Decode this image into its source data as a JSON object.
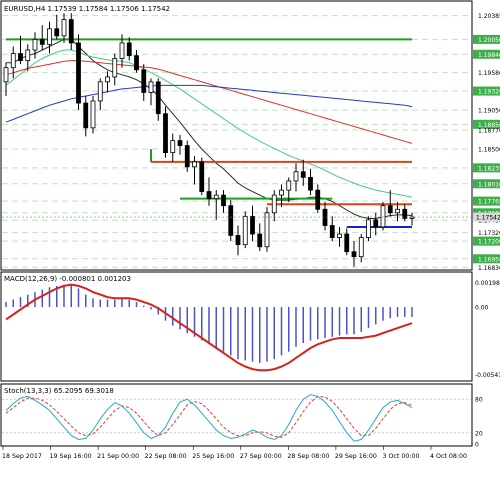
{
  "colors": {
    "bull": "#ffffff",
    "bear": "#000000",
    "grid": "#bfe3bf",
    "label_bg": "#3dae49",
    "ma_fast": "#2a2a2a",
    "ma_green": "#49c98b",
    "ma_red": "#e0302a",
    "ma_blue": "#2538c8",
    "level_green": "#1e9e1e",
    "level_red": "#d8451a",
    "level_blue": "#1326c8",
    "macd_hist": "#4b53c9",
    "macd_signal": "#d6221c",
    "stoch_main": "#26a9c9",
    "stoch_signal": "#e23a2a"
  },
  "chart_data": [
    {
      "type": "candlestick",
      "title": "EURUSD,H4 1.17539 1.17584 1.17506 1.17542",
      "ylim": [
        1.1682,
        1.2055
      ],
      "price_ticks": [
        "1.20385",
        "1.20050",
        "1.19840",
        "1.19580",
        "1.19320",
        "1.19050",
        "1.18850",
        "1.18770",
        "1.18500",
        "1.18235",
        "1.18010",
        "1.17765",
        "1.17600",
        "1.17495",
        "1.17320",
        "1.17200",
        "1.16950",
        "1.16830"
      ],
      "highlight_ticks": [
        "1.20050",
        "1.19840",
        "1.19320",
        "1.18850",
        "1.18235",
        "1.18010",
        "1.17765",
        "1.17600",
        "1.17200",
        "1.16950"
      ],
      "current_price_label": "1.17542",
      "x_tick_labels": [
        "18 Sep 2017",
        "19 Sep 16:00",
        "21 Sep 00:00",
        "22 Sep 08:00",
        "25 Sep 16:00",
        "27 Sep 00:00",
        "28 Sep 08:00",
        "29 Sep 16:00",
        "3 Oct 00:00",
        "4 Oct 08:00"
      ],
      "ohlc": [
        [
          1.1945,
          1.1972,
          1.1925,
          1.1965
        ],
        [
          1.1965,
          1.1995,
          1.195,
          1.1985
        ],
        [
          1.1985,
          1.201,
          1.197,
          1.1975
        ],
        [
          1.1975,
          1.1998,
          1.196,
          1.199
        ],
        [
          1.199,
          1.2015,
          1.1978,
          1.2005
        ],
        [
          1.2005,
          1.2025,
          1.199,
          1.1998
        ],
        [
          1.1998,
          1.203,
          1.1985,
          1.202
        ],
        [
          1.202,
          1.204,
          1.2005,
          1.201
        ],
        [
          1.201,
          1.2042,
          1.2,
          1.2033
        ],
        [
          1.2033,
          1.2042,
          1.199,
          1.2
        ],
        [
          1.2,
          1.2012,
          1.1905,
          1.1915
        ],
        [
          1.1915,
          1.1925,
          1.1868,
          1.188
        ],
        [
          1.188,
          1.1925,
          1.1872,
          1.1918
        ],
        [
          1.1918,
          1.195,
          1.1905,
          1.1945
        ],
        [
          1.1945,
          1.196,
          1.193,
          1.1952
        ],
        [
          1.1952,
          1.1985,
          1.194,
          1.1978
        ],
        [
          1.1978,
          1.2012,
          1.1965,
          1.2
        ],
        [
          1.2,
          1.2008,
          1.1975,
          1.1982
        ],
        [
          1.1982,
          1.199,
          1.1958,
          1.1962
        ],
        [
          1.1962,
          1.197,
          1.1918,
          1.193
        ],
        [
          1.193,
          1.195,
          1.1912,
          1.1945
        ],
        [
          1.1945,
          1.195,
          1.189,
          1.19
        ],
        [
          1.19,
          1.191,
          1.1838,
          1.1845
        ],
        [
          1.1845,
          1.1872,
          1.1832,
          1.1862
        ],
        [
          1.1862,
          1.187,
          1.1842,
          1.1855
        ],
        [
          1.1855,
          1.1862,
          1.1818,
          1.1825
        ],
        [
          1.1825,
          1.184,
          1.18,
          1.1832
        ],
        [
          1.1832,
          1.1838,
          1.1785,
          1.179
        ],
        [
          1.179,
          1.181,
          1.177,
          1.178
        ],
        [
          1.178,
          1.1792,
          1.175,
          1.1785
        ],
        [
          1.1785,
          1.1792,
          1.176,
          1.177
        ],
        [
          1.177,
          1.1778,
          1.172,
          1.1728
        ],
        [
          1.1728,
          1.1742,
          1.17,
          1.1715
        ],
        [
          1.1715,
          1.1762,
          1.171,
          1.1755
        ],
        [
          1.1755,
          1.177,
          1.172,
          1.173
        ],
        [
          1.173,
          1.1745,
          1.1706,
          1.1712
        ],
        [
          1.1712,
          1.1768,
          1.1705,
          1.176
        ],
        [
          1.176,
          1.1792,
          1.1748,
          1.1785
        ],
        [
          1.1785,
          1.18,
          1.1768,
          1.1792
        ],
        [
          1.1792,
          1.181,
          1.1775,
          1.1805
        ],
        [
          1.1805,
          1.183,
          1.179,
          1.1818
        ],
        [
          1.1818,
          1.1835,
          1.1798,
          1.181
        ],
        [
          1.181,
          1.1822,
          1.1785,
          1.1792
        ],
        [
          1.1792,
          1.18,
          1.176,
          1.1765
        ],
        [
          1.1765,
          1.1775,
          1.1735,
          1.1742
        ],
        [
          1.1742,
          1.1755,
          1.172,
          1.1725
        ],
        [
          1.1725,
          1.174,
          1.1712,
          1.173
        ],
        [
          1.173,
          1.1738,
          1.17,
          1.1705
        ],
        [
          1.1705,
          1.172,
          1.1684,
          1.1698
        ],
        [
          1.1698,
          1.173,
          1.169,
          1.1725
        ],
        [
          1.1725,
          1.1755,
          1.172,
          1.175
        ],
        [
          1.175,
          1.176,
          1.1728,
          1.174
        ],
        [
          1.174,
          1.1775,
          1.1735,
          1.177
        ],
        [
          1.177,
          1.1792,
          1.1755,
          1.176
        ],
        [
          1.176,
          1.1775,
          1.1748,
          1.1765
        ],
        [
          1.1765,
          1.1772,
          1.1748,
          1.1752
        ],
        [
          1.1752,
          1.176,
          1.1742,
          1.1754
        ]
      ],
      "moving_averages": [
        {
          "key": "ma_fast",
          "values": [
            1.1972,
            1.1972,
            1.1978,
            1.1982,
            1.1985,
            1.199,
            1.1995,
            1.2,
            1.2005,
            1.2005,
            1.1995,
            1.1985,
            1.1975,
            1.1968,
            1.1962,
            1.1958,
            1.1955,
            1.1952,
            1.1948,
            1.1942,
            1.1935,
            1.1925,
            1.1912,
            1.19,
            1.1888,
            1.1875,
            1.1862,
            1.185,
            1.184,
            1.183,
            1.1822,
            1.1812,
            1.1802,
            1.1795,
            1.179,
            1.1785,
            1.178,
            1.1778,
            1.1778,
            1.1778,
            1.1779,
            1.178,
            1.1782,
            1.1782,
            1.178,
            1.1776,
            1.177,
            1.1764,
            1.1758,
            1.1754,
            1.1752,
            1.1752,
            1.1754,
            1.1756,
            1.1757,
            1.1757,
            1.1756
          ]
        },
        {
          "key": "ma_green",
          "values": [
            1.194,
            1.1948,
            1.1956,
            1.1964,
            1.1972,
            1.1978,
            1.1983,
            1.1987,
            1.199,
            1.199,
            1.1987,
            1.1983,
            1.198,
            1.1978,
            1.1976,
            1.1975,
            1.1974,
            1.1972,
            1.1968,
            1.1963,
            1.1958,
            1.1953,
            1.1947,
            1.1941,
            1.1935,
            1.1928,
            1.1921,
            1.1914,
            1.1907,
            1.19,
            1.1893,
            1.1886,
            1.1879,
            1.1873,
            1.1867,
            1.1861,
            1.1856,
            1.1851,
            1.1846,
            1.1841,
            1.1837,
            1.1833,
            1.1829,
            1.1825,
            1.182,
            1.1815,
            1.181,
            1.1806,
            1.1802,
            1.1798,
            1.1795,
            1.1792,
            1.179,
            1.1788,
            1.1786,
            1.1784,
            1.1782
          ]
        },
        {
          "key": "ma_red",
          "values": [
            1.1955,
            1.1958,
            1.1961,
            1.1964,
            1.1966,
            1.1968,
            1.197,
            1.1972,
            1.1974,
            1.1975,
            1.1975,
            1.1974,
            1.1973,
            1.1972,
            1.1971,
            1.197,
            1.1969,
            1.1968,
            1.1967,
            1.1966,
            1.1965,
            1.1963,
            1.196,
            1.1957,
            1.1954,
            1.1951,
            1.1948,
            1.1945,
            1.1942,
            1.1939,
            1.1936,
            1.1933,
            1.193,
            1.1927,
            1.1924,
            1.1921,
            1.1918,
            1.1915,
            1.1912,
            1.1909,
            1.1906,
            1.1903,
            1.19,
            1.1897,
            1.1894,
            1.1891,
            1.1888,
            1.1885,
            1.1882,
            1.1879,
            1.1876,
            1.1873,
            1.187,
            1.1867,
            1.1864,
            1.1861,
            1.1858
          ]
        },
        {
          "key": "ma_blue",
          "values": [
            1.1888,
            1.1892,
            1.1896,
            1.19,
            1.1904,
            1.1908,
            1.1912,
            1.1915,
            1.1918,
            1.1921,
            1.1923,
            1.1925,
            1.1927,
            1.1929,
            1.1931,
            1.1933,
            1.1935,
            1.1936,
            1.1937,
            1.1938,
            1.1939,
            1.194,
            1.194,
            1.194,
            1.194,
            1.194,
            1.194,
            1.194,
            1.1939,
            1.1938,
            1.1937,
            1.1936,
            1.1935,
            1.1934,
            1.1933,
            1.1932,
            1.1931,
            1.193,
            1.1929,
            1.1928,
            1.1927,
            1.1926,
            1.1925,
            1.1924,
            1.1923,
            1.1922,
            1.1921,
            1.192,
            1.1919,
            1.1918,
            1.1917,
            1.1916,
            1.1915,
            1.1914,
            1.1913,
            1.1912,
            1.191
          ]
        }
      ],
      "levels": [
        {
          "price": 1.2005,
          "from": 0,
          "to": 56,
          "key": "level_green"
        },
        {
          "price": 1.1832,
          "from": 20,
          "to": 56,
          "key": "level_red"
        },
        {
          "price": 1.1832,
          "from": 20,
          "to": 20,
          "key": "level_green",
          "vertical_to": 1.185
        },
        {
          "price": 1.178,
          "from": 24,
          "to": 45,
          "key": "level_green"
        },
        {
          "price": 1.1772,
          "from": 36,
          "to": 56,
          "key": "level_red"
        },
        {
          "price": 1.174,
          "from": 47,
          "to": 56,
          "key": "level_blue"
        }
      ]
    },
    {
      "type": "macd",
      "title": "MACD(12,26,9) -0.000801 0.001203",
      "ylim": [
        -0.0058,
        0.0025
      ],
      "ticks": [
        "0.001981",
        "0.00",
        "-0.005419"
      ],
      "histogram": [
        0.0004,
        0.0006,
        0.0008,
        0.001,
        0.0012,
        0.0014,
        0.0016,
        0.0017,
        0.0018,
        0.0018,
        0.0015,
        0.001,
        0.0007,
        0.0006,
        0.0006,
        0.0006,
        0.0007,
        0.0006,
        0.0004,
        0.0001,
        -0.0002,
        -0.0006,
        -0.0011,
        -0.0015,
        -0.0018,
        -0.0021,
        -0.0024,
        -0.0027,
        -0.003,
        -0.0033,
        -0.0036,
        -0.0039,
        -0.0042,
        -0.0043,
        -0.0044,
        -0.0045,
        -0.0044,
        -0.0042,
        -0.0039,
        -0.0036,
        -0.0032,
        -0.0029,
        -0.0027,
        -0.0026,
        -0.0025,
        -0.0024,
        -0.0023,
        -0.0022,
        -0.0022,
        -0.002,
        -0.0017,
        -0.0014,
        -0.0011,
        -0.0009,
        -0.0008,
        -0.0008,
        -0.0008
      ],
      "signal": [
        -0.001,
        -0.0006,
        -0.0002,
        0.0002,
        0.0006,
        0.0009,
        0.0012,
        0.0015,
        0.0017,
        0.0018,
        0.0017,
        0.0015,
        0.0012,
        0.001,
        0.0008,
        0.0007,
        0.0007,
        0.0007,
        0.0006,
        0.0004,
        0.0002,
        -0.0001,
        -0.0005,
        -0.0009,
        -0.0013,
        -0.0017,
        -0.0021,
        -0.0025,
        -0.0029,
        -0.0033,
        -0.0037,
        -0.0041,
        -0.0045,
        -0.0048,
        -0.005,
        -0.0051,
        -0.0051,
        -0.005,
        -0.0048,
        -0.0045,
        -0.0041,
        -0.0037,
        -0.0033,
        -0.003,
        -0.0028,
        -0.0026,
        -0.0025,
        -0.0025,
        -0.0025,
        -0.0025,
        -0.0024,
        -0.0023,
        -0.0021,
        -0.0019,
        -0.0017,
        -0.0015,
        -0.0013
      ]
    },
    {
      "type": "stochastic",
      "title": "Stoch(13,3,3) 65.2095 69.3018",
      "ylim": [
        0,
        100
      ],
      "ticks": [
        "80",
        "20",
        "0"
      ],
      "main": [
        60,
        72,
        82,
        85,
        78,
        70,
        60,
        45,
        30,
        15,
        8,
        10,
        25,
        45,
        62,
        74,
        68,
        55,
        38,
        20,
        10,
        15,
        30,
        55,
        75,
        80,
        70,
        55,
        40,
        25,
        15,
        10,
        12,
        18,
        25,
        20,
        12,
        8,
        15,
        35,
        60,
        80,
        88,
        85,
        75,
        60,
        40,
        20,
        5,
        8,
        25,
        45,
        65,
        75,
        78,
        72,
        65
      ],
      "signal": [
        55,
        65,
        75,
        82,
        82,
        78,
        70,
        58,
        45,
        32,
        20,
        15,
        18,
        30,
        45,
        60,
        68,
        65,
        55,
        40,
        25,
        15,
        20,
        35,
        52,
        70,
        76,
        72,
        60,
        45,
        30,
        20,
        15,
        15,
        20,
        22,
        20,
        14,
        12,
        20,
        38,
        58,
        75,
        85,
        84,
        76,
        62,
        45,
        28,
        15,
        15,
        28,
        45,
        62,
        72,
        74,
        69
      ]
    }
  ]
}
